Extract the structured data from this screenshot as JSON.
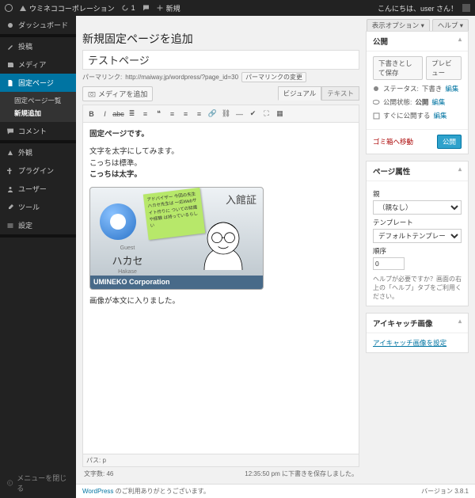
{
  "adminbar": {
    "site": "ウミネココーポレーション",
    "comments": "1",
    "new": "新規",
    "greeting": "こんにちは、user さん！"
  },
  "sidebar": {
    "dashboard": "ダッシュボード",
    "posts": "投稿",
    "media": "メディア",
    "pages": "固定ページ",
    "pages_list": "固定ページ一覧",
    "pages_new": "新規追加",
    "comments": "コメント",
    "appearance": "外観",
    "plugins": "プラグイン",
    "users": "ユーザー",
    "tools": "ツール",
    "settings": "設定",
    "collapse": "メニューを閉じる"
  },
  "screen": {
    "options": "表示オプション",
    "help": "ヘルプ",
    "heading": "新規固定ページを追加",
    "title_value": "テストページ",
    "permalink_label": "パーマリンク:",
    "permalink_url": "http://maiway.jp/wordpress/?page_id=30",
    "permalink_btn": "パーマリンクの変更",
    "add_media": "メディアを追加",
    "tab_visual": "ビジュアル",
    "tab_text": "テキスト"
  },
  "editor": {
    "l1": "固定ページです。",
    "l2": "文字を太字にしてみます。",
    "l3": "こっちは標準。",
    "l4": "こっちは太字。",
    "l5": "画像が本文に入りました。",
    "card_corp": "UMINEKO Corporation",
    "card_title": "入館証",
    "card_guestlabel": "Guest",
    "card_name_jp": "ハカセ",
    "card_name_rom": "Hakase",
    "sticky": "アドバイザー\n今回の先生\nハカセ先生は\n一応Webサイト作りに\nついての知識や経験\nは持っているらしい"
  },
  "status": {
    "path_label": "パス:",
    "path_value": "p",
    "wordcount_label": "文字数:",
    "wordcount": "46",
    "lastsave": "12:35:50 pm に下書きを保存しました。"
  },
  "publish": {
    "box_title": "公開",
    "save_draft": "下書きとして保存",
    "preview": "プレビュー",
    "status_label": "ステータス:",
    "status_value": "下書き",
    "edit": "編集",
    "vis_label": "公開状態:",
    "vis_value": "公開",
    "sched_label": "すぐに公開する",
    "trash": "ゴミ箱へ移動",
    "publish_btn": "公開"
  },
  "attrs": {
    "box_title": "ページ属性",
    "parent": "親",
    "parent_none": "（親なし）",
    "template": "テンプレート",
    "template_default": "デフォルトテンプレート",
    "order": "順序",
    "order_value": "0",
    "help": "ヘルプが必要ですか？画面の右上の「ヘルプ」タブをご利用ください。"
  },
  "thumb": {
    "box_title": "アイキャッチ画像",
    "set": "アイキャッチ画像を設定"
  },
  "footer": {
    "thanks_pre": "WordPress",
    "thanks": "のご利用ありがとうございます。",
    "version": "バージョン 3.8.1"
  }
}
